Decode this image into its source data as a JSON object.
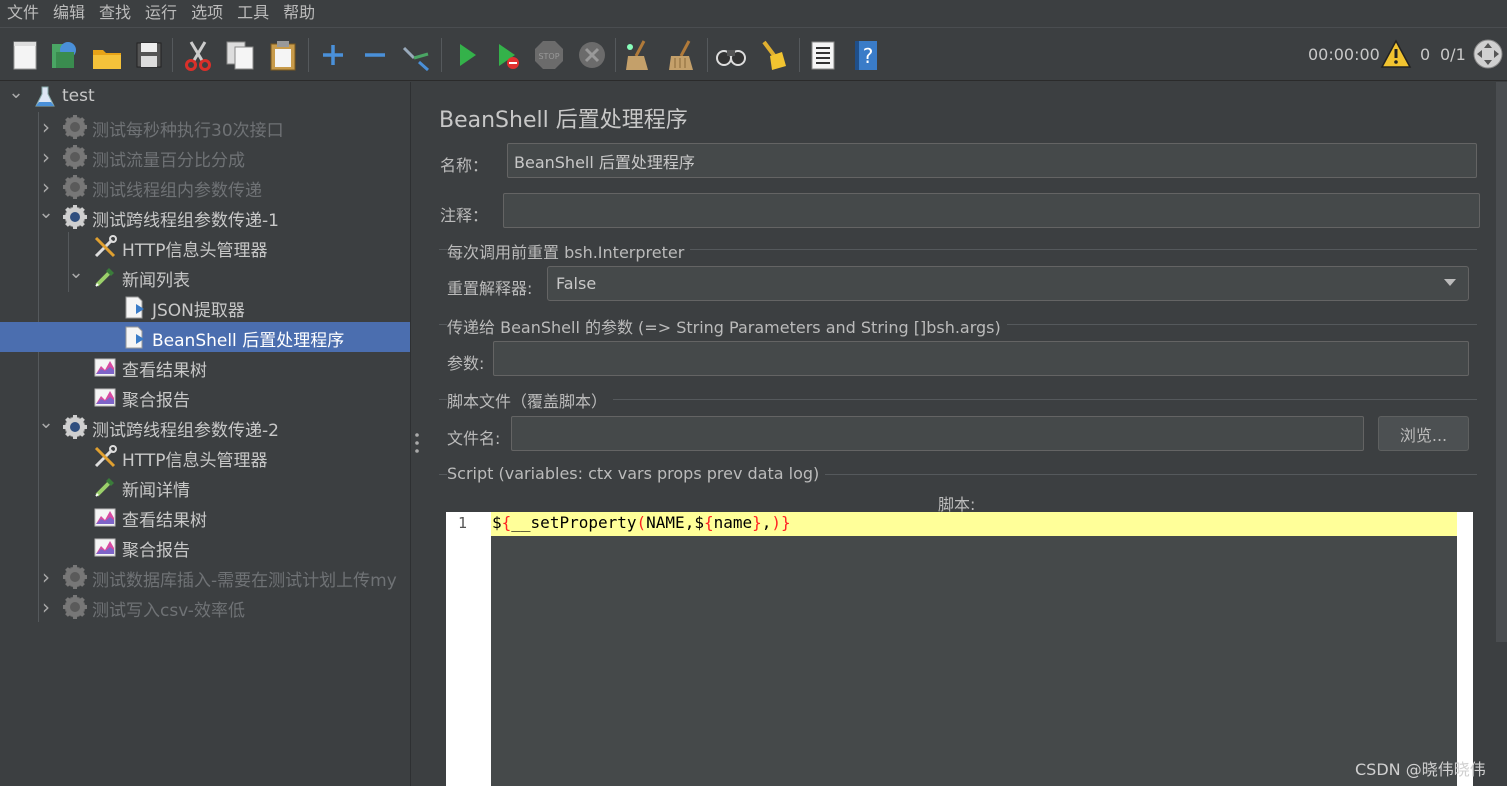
{
  "menu": [
    "文件",
    "编辑",
    "查找",
    "运行",
    "选项",
    "工具",
    "帮助"
  ],
  "toolbar": {
    "icons": [
      "new-icon",
      "templates-icon",
      "open-icon",
      "save-icon",
      "cut-icon",
      "copy-icon",
      "paste-icon",
      "expand-icon",
      "collapse-icon",
      "toggle-icon",
      "start-icon",
      "start-no-pause-icon",
      "stop-icon",
      "shutdown-icon",
      "clear-icon",
      "clear-all-icon",
      "search-icon",
      "reset-search-icon",
      "function-helper-icon",
      "help-icon"
    ],
    "timer": "00:00:00",
    "warning_count": "0",
    "threads": "0/1"
  },
  "tree": {
    "root": "test",
    "items": [
      {
        "label": "测试每秒种执行30次接口",
        "icon": "thread-group-icon",
        "state": "disabled",
        "expanded": false
      },
      {
        "label": "测试流量百分比分成",
        "icon": "thread-group-icon",
        "state": "disabled",
        "expanded": false
      },
      {
        "label": "测试线程组内参数传递",
        "icon": "thread-group-icon",
        "state": "disabled",
        "expanded": false
      },
      {
        "label": "测试跨线程组参数传递-1",
        "icon": "thread-group-icon",
        "state": "enabled",
        "expanded": true
      },
      {
        "label": "HTTP信息头管理器",
        "icon": "config-tools-icon"
      },
      {
        "label": "新闻列表",
        "icon": "sampler-pipette-icon",
        "expanded": true
      },
      {
        "label": "JSON提取器",
        "icon": "post-processor-icon"
      },
      {
        "label": "BeanShell 后置处理程序",
        "icon": "post-processor-icon",
        "selected": true
      },
      {
        "label": "查看结果树",
        "icon": "listener-chart-icon"
      },
      {
        "label": "聚合报告",
        "icon": "listener-chart-icon"
      },
      {
        "label": "测试跨线程组参数传递-2",
        "icon": "thread-group-icon",
        "state": "enabled",
        "expanded": true
      },
      {
        "label": "HTTP信息头管理器",
        "icon": "config-tools-icon"
      },
      {
        "label": "新闻详情",
        "icon": "sampler-pipette-icon"
      },
      {
        "label": "查看结果树",
        "icon": "listener-chart-icon"
      },
      {
        "label": "聚合报告",
        "icon": "listener-chart-icon"
      },
      {
        "label": "测试数据库插入-需要在测试计划上传my",
        "icon": "thread-group-icon",
        "state": "disabled",
        "expanded": false
      },
      {
        "label": "测试写入csv-效率低",
        "icon": "thread-group-icon",
        "state": "disabled",
        "expanded": false
      }
    ]
  },
  "panel": {
    "title": "BeanShell 后置处理程序",
    "name_label": "名称：",
    "name_value": "BeanShell 后置处理程序",
    "comment_label": "注释：",
    "comment_value": "",
    "reset_group": "每次调用前重置 bsh.Interpreter",
    "reset_label": "重置解释器:",
    "reset_value": "False",
    "params_group": "传递给 BeanShell 的参数 (=> String Parameters and String []bsh.args)",
    "params_label": "参数:",
    "params_value": "",
    "file_group": "脚本文件（覆盖脚本）",
    "file_label": "文件名:",
    "file_value": "",
    "browse_label": "浏览...",
    "script_group": "Script (variables: ctx vars props prev data log)",
    "script_caption": "脚本:",
    "script_line_number": "1",
    "script_parts": [
      "$",
      "{",
      "__setProperty",
      "(",
      "NAME,$",
      "{",
      "name",
      "}",
      ",",
      ")",
      "}"
    ]
  },
  "watermark": "CSDN @晓伟晓伟",
  "colors": {
    "background": "#3c3f41",
    "selection": "#4b6eaf",
    "current_line": "#ffff99",
    "bracket": "#ff2222"
  }
}
